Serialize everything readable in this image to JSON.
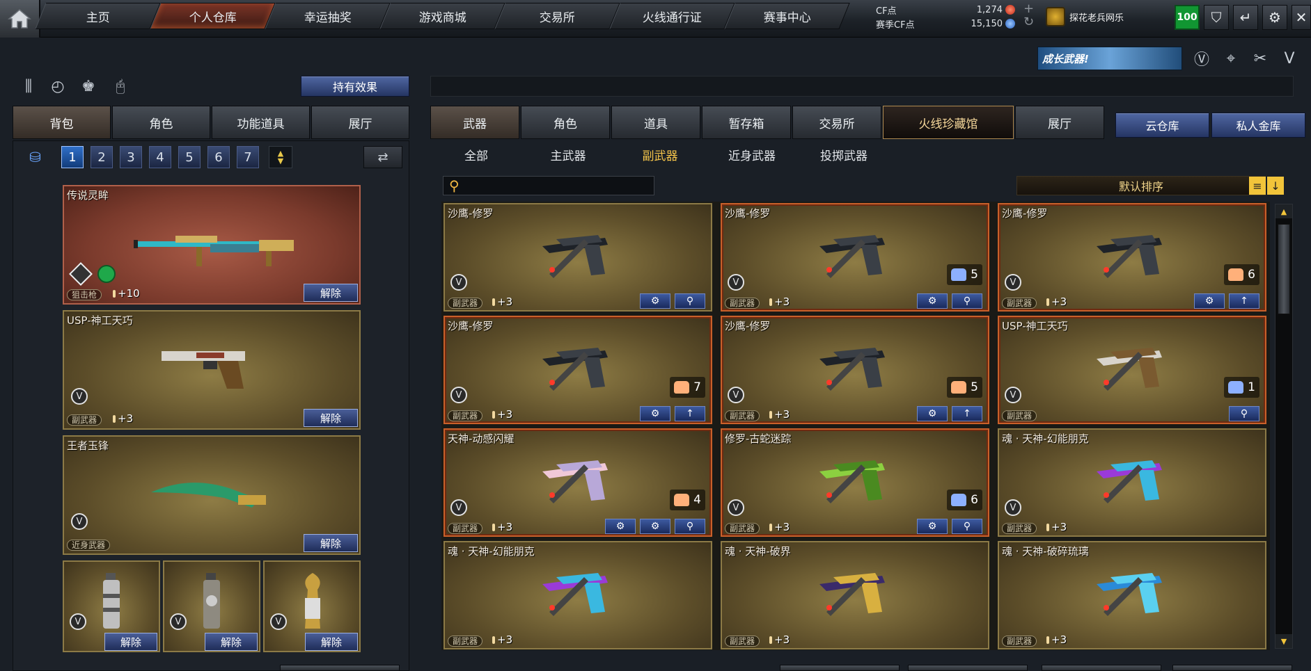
{
  "topnav": {
    "tabs": [
      "主页",
      "个人仓库",
      "幸运抽奖",
      "游戏商城",
      "交易所",
      "火线通行证",
      "赛事中心"
    ],
    "active_index": 1
  },
  "currency": {
    "cf_label": "CF点",
    "cf_value": "1,274",
    "season_label": "赛季CF点",
    "season_value": "15,150"
  },
  "player": {
    "name": "探花老兵网乐",
    "level": "100"
  },
  "banner": {
    "text": "成长武器!"
  },
  "left": {
    "effects_button": "持有效果",
    "tabs": [
      "背包",
      "角色",
      "功能道具",
      "展厅"
    ],
    "active_tab": 0,
    "pages": [
      "1",
      "2",
      "3",
      "4",
      "5",
      "6",
      "7"
    ],
    "active_page": 0,
    "unequip_label": "解除",
    "equipped": [
      {
        "name": "传说灵眸",
        "type": "狙击枪",
        "bonus": "+10"
      },
      {
        "name": "USP-神工天巧",
        "type": "副武器",
        "bonus": "+3"
      },
      {
        "name": "王者玉锋",
        "type": "近身武器",
        "bonus": ""
      }
    ]
  },
  "right": {
    "tabs": [
      "武器",
      "角色",
      "道具",
      "暂存箱",
      "交易所",
      "火线珍藏馆",
      "展厅"
    ],
    "active_tab": 0,
    "storage_buttons": [
      "云仓库",
      "私人金库"
    ],
    "subtabs": [
      "全部",
      "主武器",
      "副武器",
      "近身武器",
      "投掷武器"
    ],
    "active_subtab": 2,
    "search_placeholder": "",
    "sort_label": "默认排序",
    "items": [
      {
        "name": "沙鹰-修罗",
        "type": "副武器",
        "bonus": "+3",
        "count": ""
      },
      {
        "name": "沙鹰-修罗",
        "type": "副武器",
        "bonus": "+3",
        "count": "5"
      },
      {
        "name": "沙鹰-修罗",
        "type": "副武器",
        "bonus": "+3",
        "count": "6"
      },
      {
        "name": "沙鹰-修罗",
        "type": "副武器",
        "bonus": "+3",
        "count": "7"
      },
      {
        "name": "沙鹰-修罗",
        "type": "副武器",
        "bonus": "+3",
        "count": "5"
      },
      {
        "name": "USP-神工天巧",
        "type": "副武器",
        "bonus": "",
        "count": "1"
      },
      {
        "name": "天神-动感闪耀",
        "type": "副武器",
        "bonus": "+3",
        "count": "4"
      },
      {
        "name": "修罗-古蛇迷踪",
        "type": "副武器",
        "bonus": "+3",
        "count": "6"
      },
      {
        "name": "魂 · 天神-幻能朋克",
        "type": "副武器",
        "bonus": "+3",
        "count": ""
      },
      {
        "name": "魂 · 天神-幻能朋克",
        "type": "副武器",
        "bonus": "+3",
        "count": ""
      },
      {
        "name": "魂 · 天神-破界",
        "type": "副武器",
        "bonus": "+3",
        "count": ""
      },
      {
        "name": "魂 · 天神-破碎琉璃",
        "type": "副武器",
        "bonus": "+3",
        "count": ""
      }
    ]
  },
  "colors": {
    "accent_blue": "#2f6fc8",
    "active_tab_red": "#7a3426",
    "gold_text": "#f4c44a",
    "level_green": "#119632"
  }
}
